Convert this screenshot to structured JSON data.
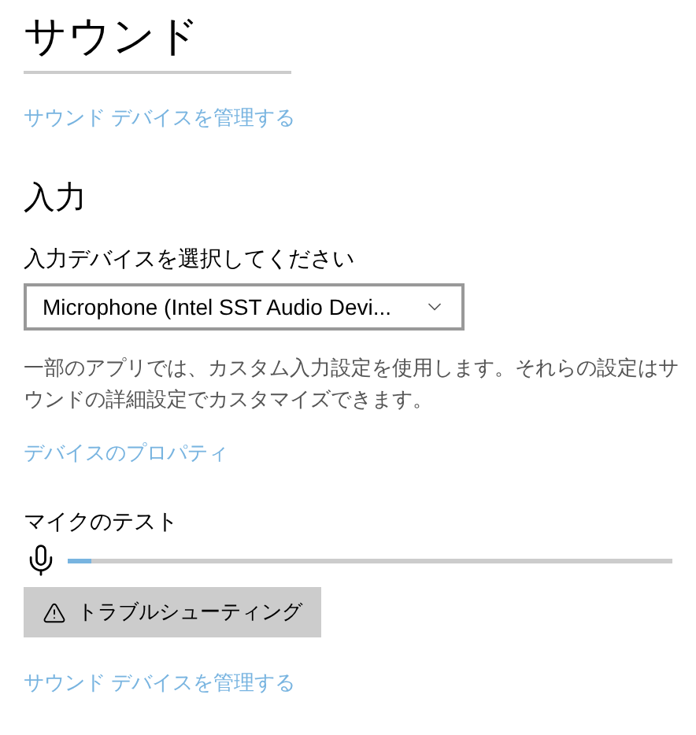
{
  "title": "サウンド",
  "manage_link_top": "サウンド デバイスを管理する",
  "section_title": "入力",
  "device_label": "入力デバイスを選択してください",
  "device_select": {
    "value": "Microphone (Intel SST Audio Devi..."
  },
  "description": "一部のアプリでは、カスタム入力設定を使用します。それらの設定はサウンドの詳細設定でカスタマイズできます。",
  "properties_link": "デバイスのプロパティ",
  "mic_test": {
    "label": "マイクのテスト",
    "level": 0.04
  },
  "troubleshoot_button": "トラブルシューティング",
  "manage_link_bottom": "サウンド デバイスを管理する"
}
